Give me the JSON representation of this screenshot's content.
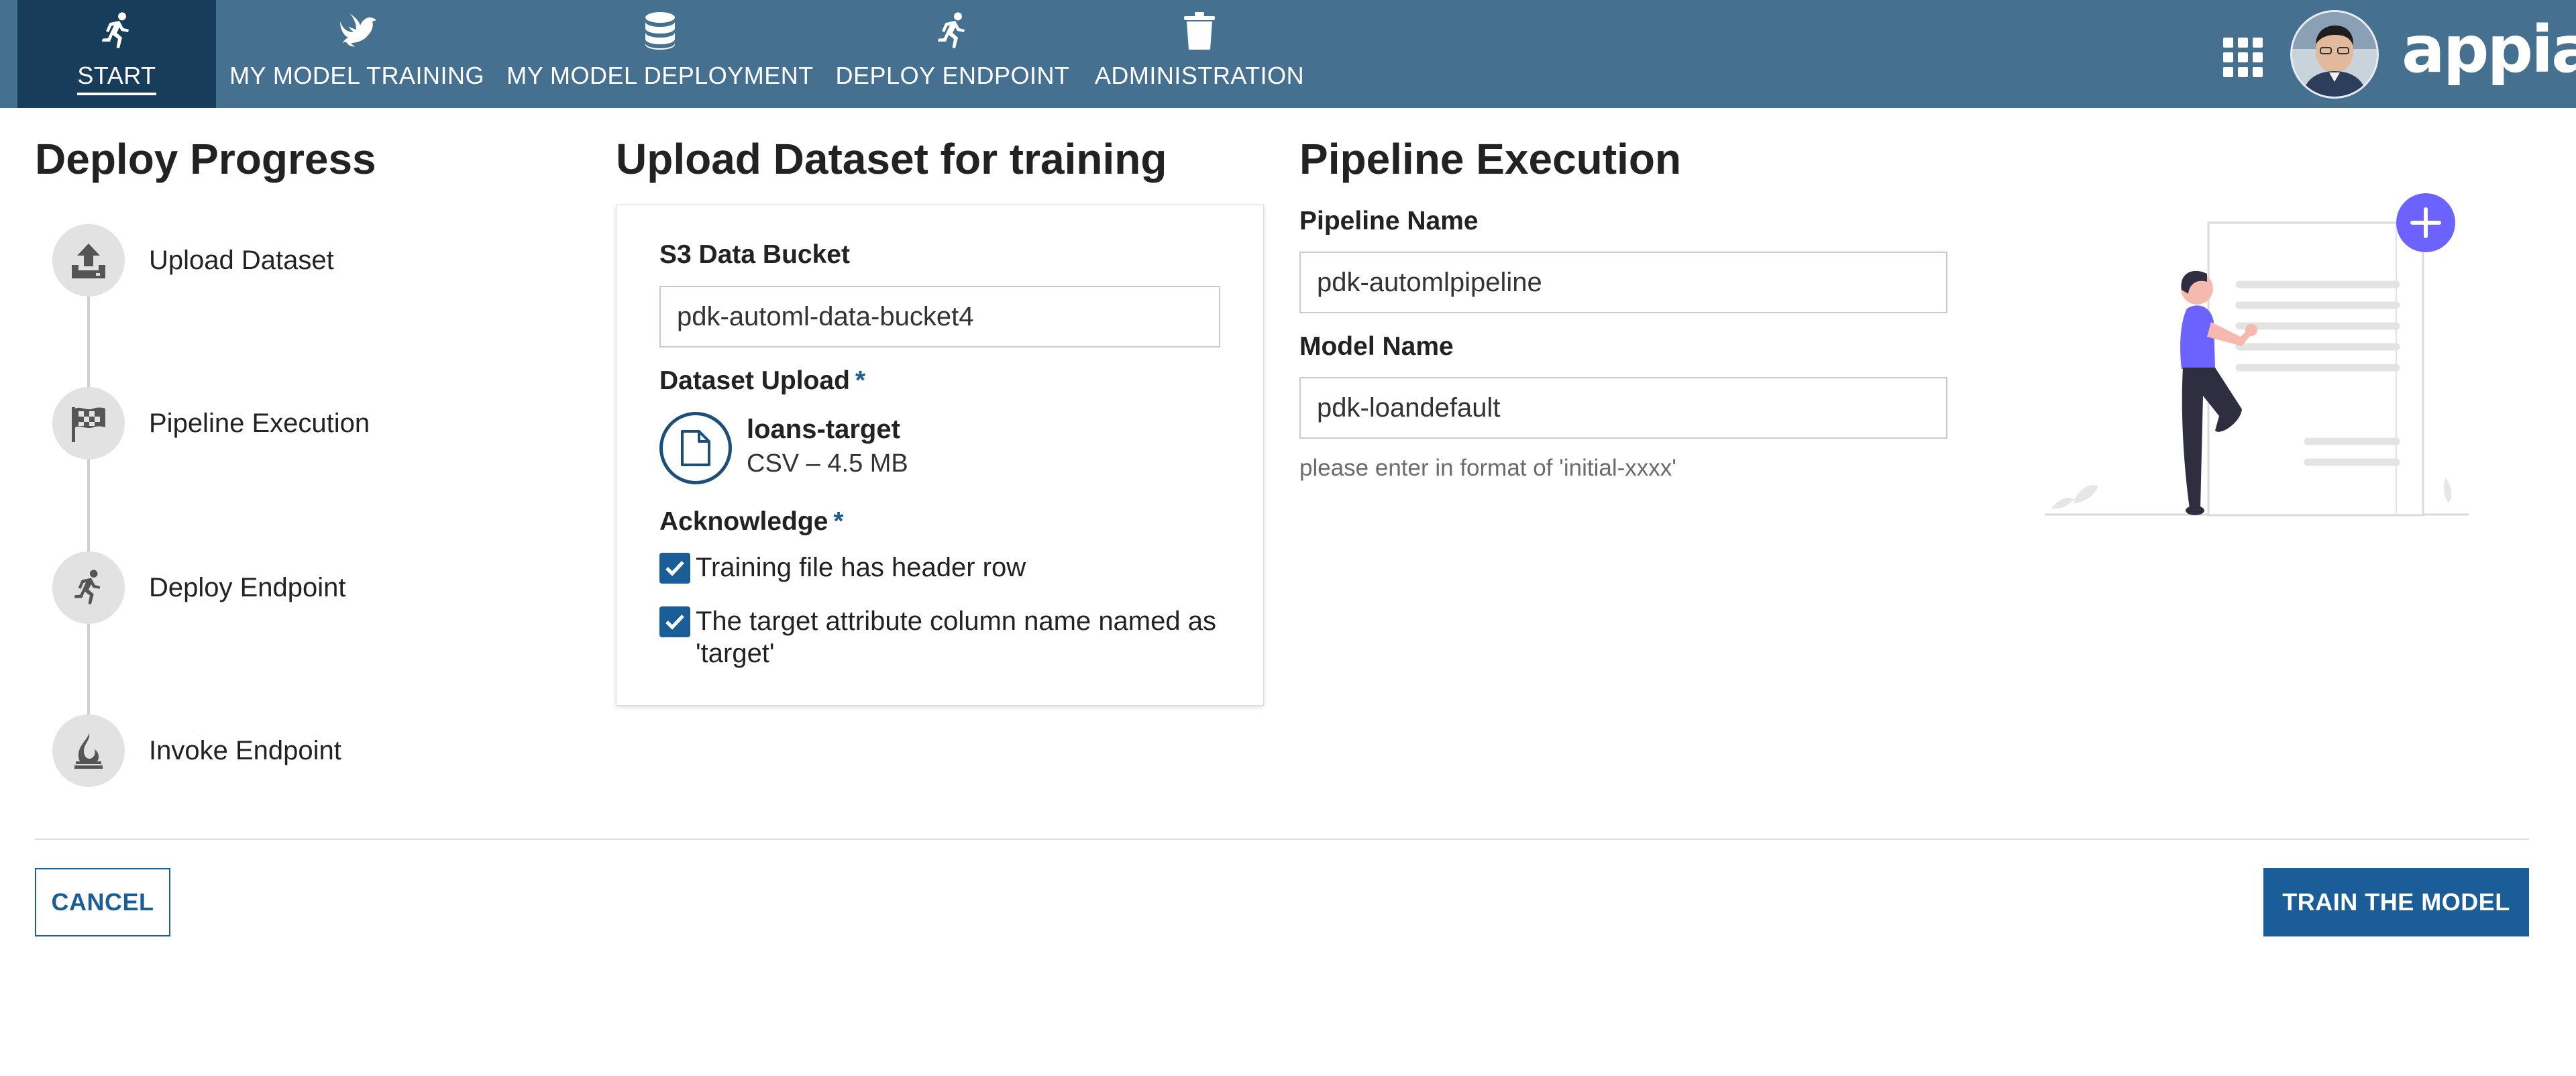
{
  "nav": {
    "tabs": [
      {
        "label": "START",
        "icon": "running-person-icon",
        "active": true
      },
      {
        "label": "MY MODEL TRAINING",
        "icon": "dove-icon"
      },
      {
        "label": "MY MODEL DEPLOYMENT",
        "icon": "database-icon"
      },
      {
        "label": "DEPLOY ENDPOINT",
        "icon": "running-person-icon"
      },
      {
        "label": "ADMINISTRATION",
        "icon": "trash-icon"
      }
    ],
    "apps_icon": "grid-icon",
    "logo_text": "appian"
  },
  "progress": {
    "title": "Deploy Progress",
    "steps": [
      {
        "label": "Upload Dataset",
        "icon": "upload-icon"
      },
      {
        "label": "Pipeline Execution",
        "icon": "checkered-flag-icon"
      },
      {
        "label": "Deploy Endpoint",
        "icon": "running-person-icon"
      },
      {
        "label": "Invoke Endpoint",
        "icon": "fire-icon"
      }
    ]
  },
  "upload": {
    "title": "Upload Dataset for training",
    "bucket_label": "S3 Data Bucket",
    "bucket_value": "pdk-automl-data-bucket4",
    "dataset_label": "Dataset Upload",
    "required_mark": "*",
    "file_name": "loans-target",
    "file_meta": "CSV – 4.5 MB",
    "ack_label": "Acknowledge",
    "ack_items": [
      {
        "label": "Training file has header row",
        "checked": true
      },
      {
        "label": "The target attribute column name named as 'target'",
        "checked": true
      }
    ]
  },
  "pipeline": {
    "title": "Pipeline Execution",
    "name_label": "Pipeline Name",
    "name_value": "pdk-automlpipeline",
    "model_label": "Model Name",
    "model_value": "pdk-loandefault",
    "model_hint": "please enter in format of 'initial-xxxx'"
  },
  "footer": {
    "cancel_label": "CANCEL",
    "train_label": "TRAIN THE MODEL"
  },
  "colors": {
    "nav_bg": "#46708f",
    "nav_active": "#173d5b",
    "accent": "#1a5d97",
    "illustration_accent": "#6c63ff"
  }
}
